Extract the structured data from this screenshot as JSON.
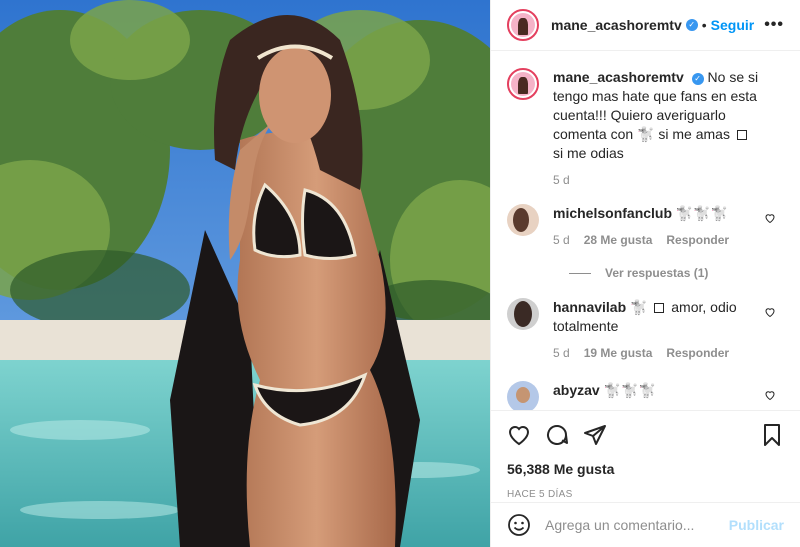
{
  "post": {
    "author": "mane_acashoremtv",
    "follow_label": "Seguir",
    "separator": "•",
    "more_label": "•••",
    "caption": {
      "username": "mane_acashoremtv",
      "text_a": "No se si tengo mas hate que fans en esta cuenta!!! Quiero averiguarlo comenta con",
      "emoji": "🐩",
      "text_b": "si me amas",
      "text_c": "si me odias",
      "time": "5 d"
    },
    "comments": [
      {
        "username": "michelsonfanclub",
        "text": "🐩🐩🐩",
        "time": "5 d",
        "likes": "28 Me gusta",
        "reply": "Responder",
        "view_replies": "Ver respuestas (1)"
      },
      {
        "username": "hannavilab",
        "emoji": "🐩",
        "text": "amor, odio totalmente",
        "time": "5 d",
        "likes": "19 Me gusta",
        "reply": "Responder"
      },
      {
        "username": "abyzav",
        "text": "🐩🐩🐩"
      }
    ],
    "likes_count": "56,388 Me gusta",
    "posted_ago": "HACE 5 DÍAS",
    "comment_placeholder": "Agrega un comentario...",
    "publish_label": "Publicar"
  },
  "colors": {
    "accent": "#0095f6",
    "verified": "#3897f0",
    "muted": "#8e8e8e",
    "publish_disabled": "#b2dffc"
  },
  "icons": [
    "verified-badge-icon",
    "more-options-icon",
    "heart-icon",
    "comment-icon",
    "share-icon",
    "bookmark-icon",
    "emoji-icon"
  ]
}
